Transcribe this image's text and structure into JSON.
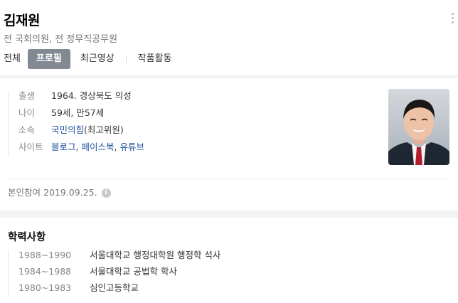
{
  "header": {
    "name": "김재원",
    "subtitle": "전 국회의원, 전 정무직공무원"
  },
  "tabs": [
    {
      "label": "전체",
      "active": false
    },
    {
      "label": "프로필",
      "active": true
    },
    {
      "label": "최근영상",
      "active": false
    },
    {
      "label": "작품활동",
      "active": false
    }
  ],
  "profile": {
    "rows": {
      "birth": {
        "key": "출생",
        "value": "1964. 경상북도 의성"
      },
      "age": {
        "key": "나이",
        "value": "59세, 만57세"
      },
      "party": {
        "key": "소속",
        "party_link": "국민의힘",
        "role": "(최고위원)"
      },
      "sites": {
        "key": "사이트",
        "links": [
          "블로그",
          "페이스북",
          "유튜브"
        ],
        "separator": ", "
      }
    },
    "verify": {
      "label": "본인참여",
      "date": "2019.09.25."
    }
  },
  "education": {
    "title": "학력사항",
    "items": [
      {
        "period": "1988~1990",
        "desc": "서울대학교 행정대학원 행정학 석사"
      },
      {
        "period": "1984~1988",
        "desc": "서울대학교 공법학 학사"
      },
      {
        "period": "1980~1983",
        "desc": "심인고등학교"
      }
    ]
  },
  "colors": {
    "active_tab_bg": "#838992",
    "link": "#1b4e9b",
    "band": "#f2f3f5"
  }
}
